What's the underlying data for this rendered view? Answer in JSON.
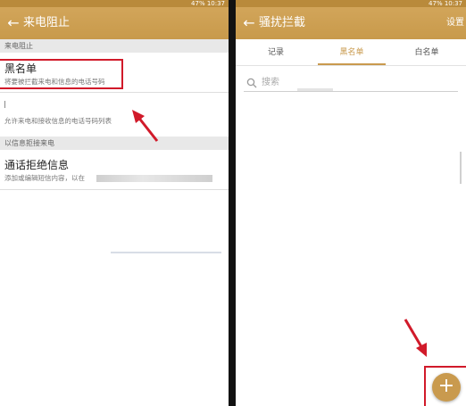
{
  "left": {
    "status_text": "47% 10:37",
    "title": "来电阻止",
    "section_1": "来电阻止",
    "blacklist": {
      "title": "黑名单",
      "subtitle": "将要被拦截来电和信息的电话号码"
    },
    "whitelist": {
      "subtitle": "允许来电和接收信息的电话号码列表"
    },
    "section_2": "以信息拒接来电",
    "reject_message": {
      "title": "通话拒绝信息",
      "subtitle": "添加或编辑短信内容，以在"
    }
  },
  "right": {
    "status_text": "47% 10:37",
    "title": "骚扰拦截",
    "settings": "设置",
    "tabs": [
      "记录",
      "黑名单",
      "白名单"
    ],
    "active_tab": 1,
    "search_placeholder": "搜索",
    "fab_label": "+"
  },
  "colors": {
    "accent": "#c99a4e",
    "annotation_red": "#d11a2a",
    "appbar": "#d2a55a"
  }
}
